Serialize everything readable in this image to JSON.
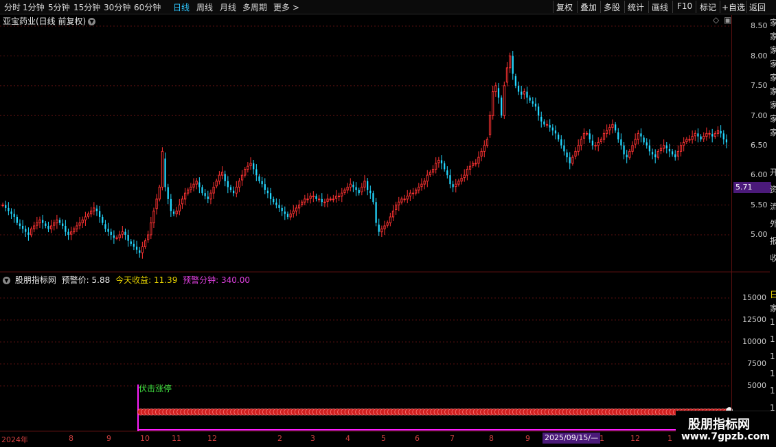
{
  "toolbar": {
    "periods": [
      "分时",
      "1分钟",
      "5分钟",
      "15分钟",
      "30分钟",
      "60分钟",
      "日线",
      "周线",
      "月线",
      "多周期",
      "更多 >"
    ],
    "active_period": "日线",
    "tools": [
      "复权",
      "叠加",
      "多股",
      "统计",
      "画线",
      "F10",
      "标记",
      "+自选",
      "返回"
    ]
  },
  "chart_title": "亚宝药业(日线 前复权)",
  "price_axis": [
    "8.50",
    "8.00",
    "7.50",
    "7.00",
    "6.50",
    "6.00",
    "5.50",
    "5.00"
  ],
  "current_price_tag": "5.71",
  "indicator": {
    "name": "股朋指标网",
    "warn_price_label": "预警价:",
    "warn_price_value": "5.88",
    "today_return_label": "今天收益:",
    "today_return_value": "11.39",
    "warn_minutes_label": "预警分钟:",
    "warn_minutes_value": "340.00",
    "signal_text": "伏击涨停",
    "axis": [
      "15000",
      "12500",
      "10000",
      "7500",
      "5000"
    ]
  },
  "dates": [
    "2024年",
    "8",
    "9",
    "10",
    "11",
    "12",
    "2",
    "3",
    "4",
    "5",
    "6",
    "7",
    "8",
    "9",
    "1",
    "12",
    "1"
  ],
  "date_tag": "2025/09/15/—",
  "watermark": {
    "line1": "股朋指标网",
    "line2": "www.7gpzb.com"
  },
  "right_strip": [
    "家",
    "家",
    "家",
    "家",
    "家",
    "家",
    "家",
    "家",
    "家",
    "开",
    "资",
    "流",
    "外",
    "报",
    "收",
    "日",
    "家",
    "1",
    "1",
    "1",
    "1",
    "1",
    "1"
  ],
  "colors": {
    "up": "#ff3232",
    "down": "#23d7ff",
    "accent": "#2ec7ff",
    "tag": "#4b1a7a",
    "gridline": "#5a1010"
  },
  "chart_data": {
    "type": "candlestick",
    "y_range": [
      4.6,
      8.65
    ],
    "closes": [
      5.5,
      5.45,
      5.4,
      5.35,
      5.3,
      5.2,
      5.15,
      5.1,
      5.05,
      5.0,
      5.1,
      5.15,
      5.2,
      5.25,
      5.2,
      5.15,
      5.1,
      5.15,
      5.2,
      5.25,
      5.2,
      5.15,
      5.05,
      5.0,
      5.05,
      5.1,
      5.15,
      5.2,
      5.25,
      5.3,
      5.35,
      5.4,
      5.45,
      5.4,
      5.3,
      5.2,
      5.1,
      5.05,
      5.0,
      4.95,
      4.95,
      5.0,
      5.05,
      5.0,
      4.9,
      4.85,
      4.8,
      4.75,
      4.7,
      4.8,
      4.9,
      5.0,
      5.2,
      5.4,
      5.6,
      5.8,
      6.4,
      5.8,
      5.6,
      5.4,
      5.35,
      5.4,
      5.5,
      5.6,
      5.7,
      5.75,
      5.8,
      5.85,
      5.9,
      5.8,
      5.7,
      5.65,
      5.6,
      5.7,
      5.8,
      5.9,
      6.0,
      6.05,
      5.9,
      5.8,
      5.75,
      5.7,
      5.8,
      5.9,
      6.0,
      6.1,
      6.15,
      6.2,
      6.1,
      6.0,
      5.9,
      5.85,
      5.75,
      5.7,
      5.6,
      5.55,
      5.5,
      5.45,
      5.4,
      5.35,
      5.3,
      5.35,
      5.4,
      5.45,
      5.5,
      5.55,
      5.6,
      5.6,
      5.65,
      5.65,
      5.6,
      5.6,
      5.55,
      5.55,
      5.6,
      5.6,
      5.6,
      5.65,
      5.65,
      5.7,
      5.75,
      5.8,
      5.85,
      5.8,
      5.75,
      5.7,
      5.8,
      5.9,
      5.75,
      5.7,
      5.55,
      5.2,
      5.05,
      5.1,
      5.15,
      5.2,
      5.3,
      5.4,
      5.5,
      5.55,
      5.6,
      5.6,
      5.65,
      5.7,
      5.7,
      5.75,
      5.8,
      5.85,
      5.9,
      6.0,
      6.05,
      6.1,
      6.2,
      6.25,
      6.2,
      6.1,
      6.0,
      5.85,
      5.8,
      5.85,
      5.9,
      5.95,
      6.0,
      6.1,
      6.15,
      6.2,
      6.2,
      6.3,
      6.4,
      6.5,
      6.6,
      7.0,
      7.4,
      7.5,
      7.3,
      7.0,
      7.5,
      7.8,
      8.0,
      7.7,
      7.5,
      7.4,
      7.35,
      7.4,
      7.3,
      7.25,
      7.2,
      7.15,
      7.0,
      6.9,
      6.85,
      6.85,
      6.8,
      6.75,
      6.7,
      6.6,
      6.5,
      6.4,
      6.3,
      6.2,
      6.3,
      6.4,
      6.5,
      6.6,
      6.7,
      6.7,
      6.6,
      6.5,
      6.5,
      6.55,
      6.6,
      6.7,
      6.75,
      6.8,
      6.85,
      6.75,
      6.6,
      6.5,
      6.35,
      6.3,
      6.4,
      6.5,
      6.6,
      6.7,
      6.65,
      6.55,
      6.5,
      6.4,
      6.35,
      6.3,
      6.4,
      6.45,
      6.5,
      6.45,
      6.4,
      6.35,
      6.3,
      6.4,
      6.5,
      6.55,
      6.6,
      6.6,
      6.65,
      6.7,
      6.65,
      6.6,
      6.65,
      6.7,
      6.7,
      6.65,
      6.7,
      6.75,
      6.7,
      6.6,
      6.55
    ]
  }
}
